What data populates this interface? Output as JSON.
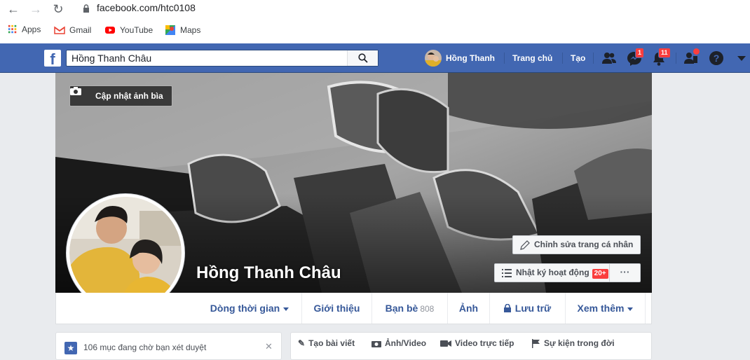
{
  "browser": {
    "url": "facebook.com/htc0108",
    "bookmarks": [
      {
        "label": "Apps",
        "icon": "apps-grid-icon"
      },
      {
        "label": "Gmail",
        "icon": "gmail-icon"
      },
      {
        "label": "YouTube",
        "icon": "youtube-icon"
      },
      {
        "label": "Maps",
        "icon": "maps-icon"
      }
    ]
  },
  "topbar": {
    "search_value": "Hồng Thanh Châu",
    "user_name": "Hồng Thanh",
    "home_label": "Trang chủ",
    "create_label": "Tạo",
    "messenger_badge": "1",
    "notifications_badge": "11",
    "colors": {
      "bar": "#4267b2",
      "badge": "#fa3e3e"
    }
  },
  "cover": {
    "update_cover_label": "Cập nhật ảnh bìa",
    "edit_profile_label": "Chỉnh sửa trang cá nhân",
    "activity_log_label": "Nhật ký hoạt động",
    "activity_count": "20+",
    "more_label": "···",
    "profile_name": "Hồng Thanh Châu"
  },
  "tabs": [
    {
      "label": "Dòng thời gian",
      "dropdown": true
    },
    {
      "label": "Giới thiệu"
    },
    {
      "label": "Bạn bè",
      "count": "808"
    },
    {
      "label": "Ảnh"
    },
    {
      "label": "Lưu trữ"
    },
    {
      "label": "Xem thêm",
      "dropdown": true
    }
  ],
  "composer": {
    "pending_text": "106 mục đang chờ bạn xét duyệt",
    "actions": [
      "Tạo bài viết",
      "Ảnh/Video",
      "Video trực tiếp",
      "Sự kiện trong đời"
    ]
  }
}
